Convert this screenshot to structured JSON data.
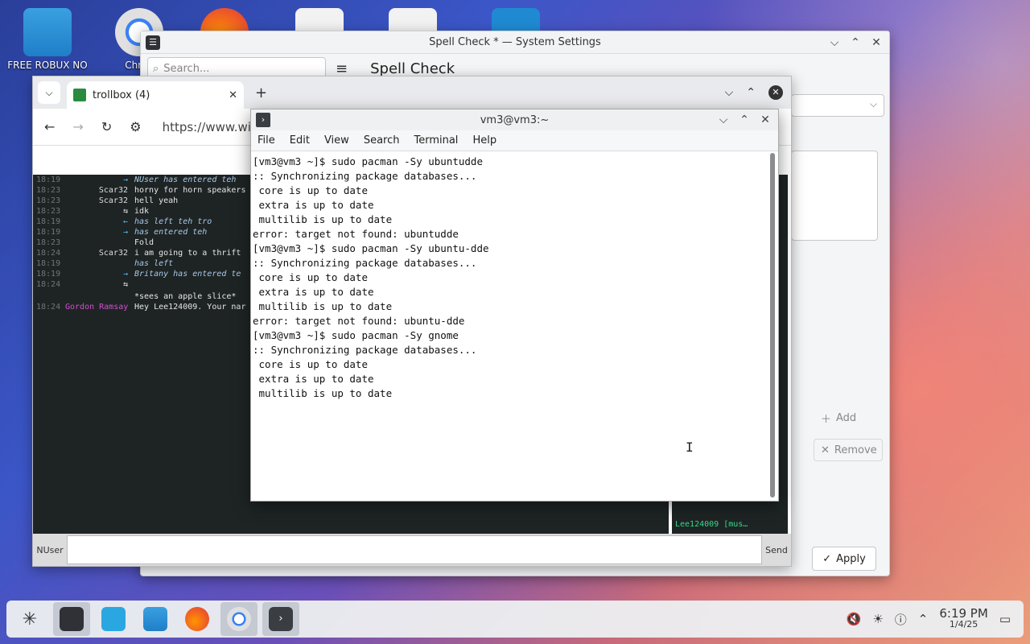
{
  "desktop": {
    "icons": [
      {
        "label": "FREE ROBUX NO"
      },
      {
        "label": "Chron"
      }
    ]
  },
  "settings": {
    "title": "Spell Check * — System Settings",
    "search_placeholder": "Search...",
    "page_title": "Spell Check",
    "add_label": "Add",
    "remove_label": "Remove",
    "apply_label": "Apply"
  },
  "browser": {
    "tab_title": "trollbox (4)",
    "url": "https://www.wind",
    "chat": [
      {
        "time": "18:19",
        "nick": "→",
        "msg": "NUser has entered teh",
        "sys": true
      },
      {
        "time": "18:23",
        "nick": "Scar32",
        "msg": "horny for horn speakers",
        "sys": false
      },
      {
        "time": "18:23",
        "nick": "Scar32",
        "msg": "hell yeah",
        "sys": false
      },
      {
        "time": "18:23",
        "nick": "⇆",
        "msg": "idk",
        "sys": false
      },
      {
        "time": "18:19",
        "nick": "←",
        "msg": "has left teh tro",
        "sys": true
      },
      {
        "time": "18:19",
        "nick": "→",
        "msg": "has entered teh",
        "sys": true
      },
      {
        "time": "18:23",
        "nick": "",
        "msg": "Fold",
        "sys": false
      },
      {
        "time": "18:24",
        "nick": "Scar32",
        "msg": "i am going to a thrift",
        "sys": false
      },
      {
        "time": "18:19",
        "nick": "",
        "msg": "has left",
        "sys": true
      },
      {
        "time": "18:19",
        "nick": "→",
        "msg": "Britany has entered te",
        "sys": true
      },
      {
        "time": "18:24",
        "nick": "⇆",
        "msg": "",
        "sys": false
      },
      {
        "time": "",
        "nick": "",
        "msg": "*sees an apple  slice*",
        "sys": false
      },
      {
        "time": "18:24",
        "nick": "Gordon Ramsay",
        "msg": "Hey Lee124009. Your nar",
        "sys": false
      }
    ],
    "user_footer": "Lee124009 [mus…",
    "input_nick": "NUser",
    "send_label": "Send"
  },
  "terminal": {
    "title": "vm3@vm3:~",
    "menu": [
      "File",
      "Edit",
      "View",
      "Search",
      "Terminal",
      "Help"
    ],
    "lines": [
      "[vm3@vm3 ~]$ sudo pacman -Sy ubuntudde",
      ":: Synchronizing package databases...",
      " core is up to date",
      " extra is up to date",
      " multilib is up to date",
      "error: target not found: ubuntudde",
      "[vm3@vm3 ~]$ sudo pacman -Sy ubuntu-dde",
      ":: Synchronizing package databases...",
      " core is up to date",
      " extra is up to date",
      " multilib is up to date",
      "error: target not found: ubuntu-dde",
      "[vm3@vm3 ~]$ sudo pacman -Sy gnome",
      ":: Synchronizing package databases...",
      " core is up to date",
      " extra is up to date",
      " multilib is up to date"
    ]
  },
  "taskbar": {
    "time": "6:19 PM",
    "date": "1/4/25"
  },
  "colors": {
    "chat_bg": "#1e2424",
    "join_color": "#4fc3f7",
    "gordon_color": "#d04fd0",
    "footer_nick_color": "#39d98a"
  }
}
